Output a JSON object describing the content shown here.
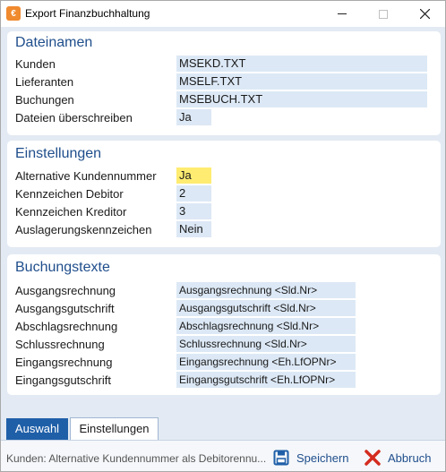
{
  "window": {
    "title": "Export Finanzbuchhaltung"
  },
  "dateinamen": {
    "title": "Dateinamen",
    "rows": [
      {
        "label": "Kunden",
        "value": "MSEKD.TXT"
      },
      {
        "label": "Lieferanten",
        "value": "MSELF.TXT"
      },
      {
        "label": "Buchungen",
        "value": "MSEBUCH.TXT"
      },
      {
        "label": "Dateien überschreiben",
        "value": "Ja"
      }
    ]
  },
  "einstellungen": {
    "title": "Einstellungen",
    "rows": [
      {
        "label": "Alternative Kundennummer",
        "value": "Ja"
      },
      {
        "label": "Kennzeichen Debitor",
        "value": "2"
      },
      {
        "label": "Kennzeichen Kreditor",
        "value": "3"
      },
      {
        "label": "Auslagerungskennzeichen",
        "value": "Nein"
      }
    ]
  },
  "buchungstexte": {
    "title": "Buchungstexte",
    "rows": [
      {
        "label": "Ausgangsrechnung",
        "value": "Ausgangsrechnung <Sld.Nr>"
      },
      {
        "label": "Ausgangsgutschrift",
        "value": "Ausgangsgutschrift <Sld.Nr>"
      },
      {
        "label": "Abschlagsrechnung",
        "value": "Abschlagsrechnung <Sld.Nr>"
      },
      {
        "label": "Schlussrechnung",
        "value": "Schlussrechnung <Sld.Nr>"
      },
      {
        "label": "Eingangsrechnung",
        "value": "Eingangsrechnung <Eh.LfOPNr>"
      },
      {
        "label": "Eingangsgutschrift",
        "value": "Eingangsgutschrift <Eh.LfOPNr>"
      }
    ]
  },
  "tabs": [
    {
      "label": "Auswahl",
      "active": false
    },
    {
      "label": "Einstellungen",
      "active": true
    }
  ],
  "statusbar": {
    "text": "Kunden: Alternative Kundennummer als Debitorennu...",
    "save_label": "Speichern",
    "cancel_label": "Abbruch"
  },
  "colors": {
    "accent": "#1f4e8c",
    "field_bg": "#dce8f5",
    "highlight": "#ffec70",
    "tab_active": "#1f5fa8"
  }
}
